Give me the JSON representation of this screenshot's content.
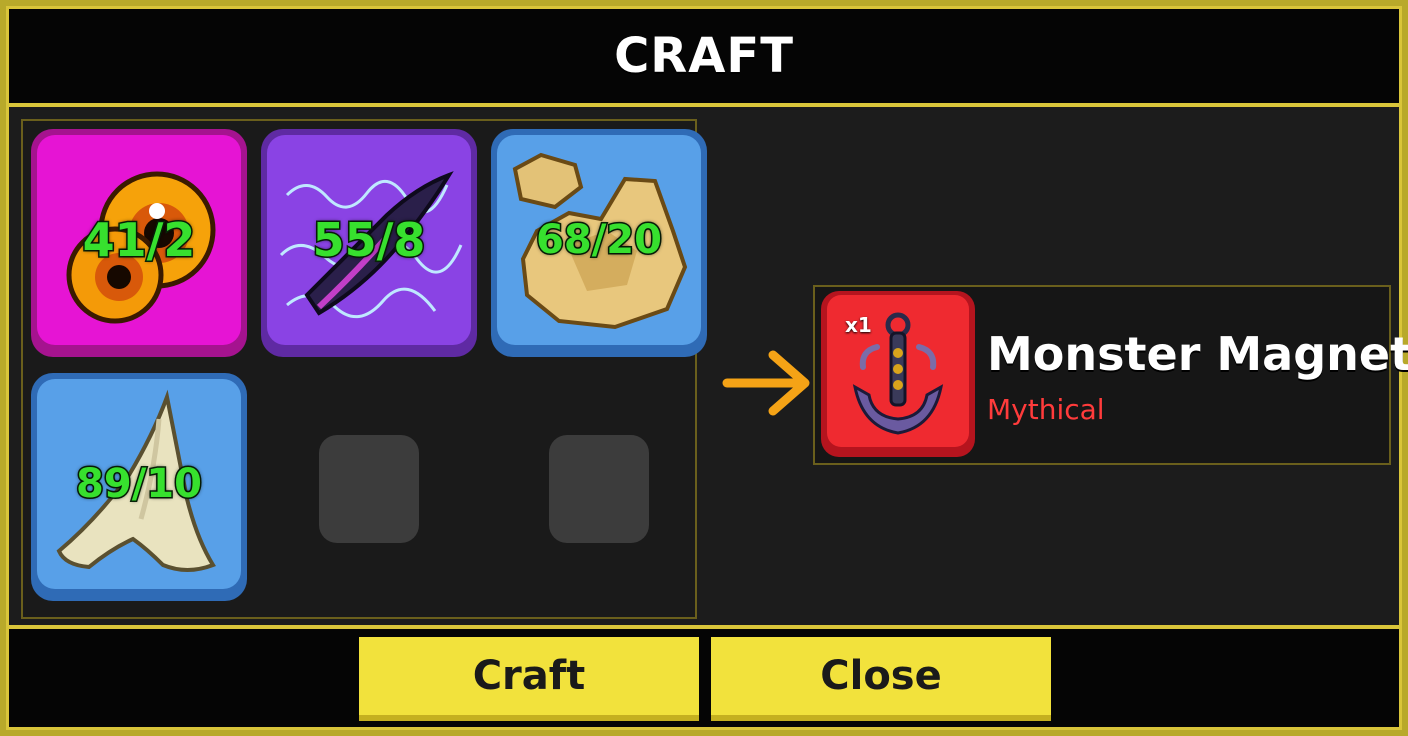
{
  "window": {
    "title": "CRAFT"
  },
  "ingredients": [
    {
      "count": "41/2",
      "icon": "eyeball-icon",
      "rarity_color": "#e614d4"
    },
    {
      "count": "55/8",
      "icon": "electric-scale-icon",
      "rarity_color": "#8a43e4"
    },
    {
      "count": "68/20",
      "icon": "gold-ore-icon",
      "rarity_color": "#58a0e8"
    },
    {
      "count": "89/10",
      "icon": "shark-tooth-icon",
      "rarity_color": "#58a0e8"
    }
  ],
  "result": {
    "quantity": "x1",
    "name": "Monster Magnet",
    "rarity": "Mythical",
    "icon": "anchor-magnet-icon",
    "rarity_color": "#ff3b3b"
  },
  "buttons": {
    "craft": "Craft",
    "close": "Close"
  }
}
